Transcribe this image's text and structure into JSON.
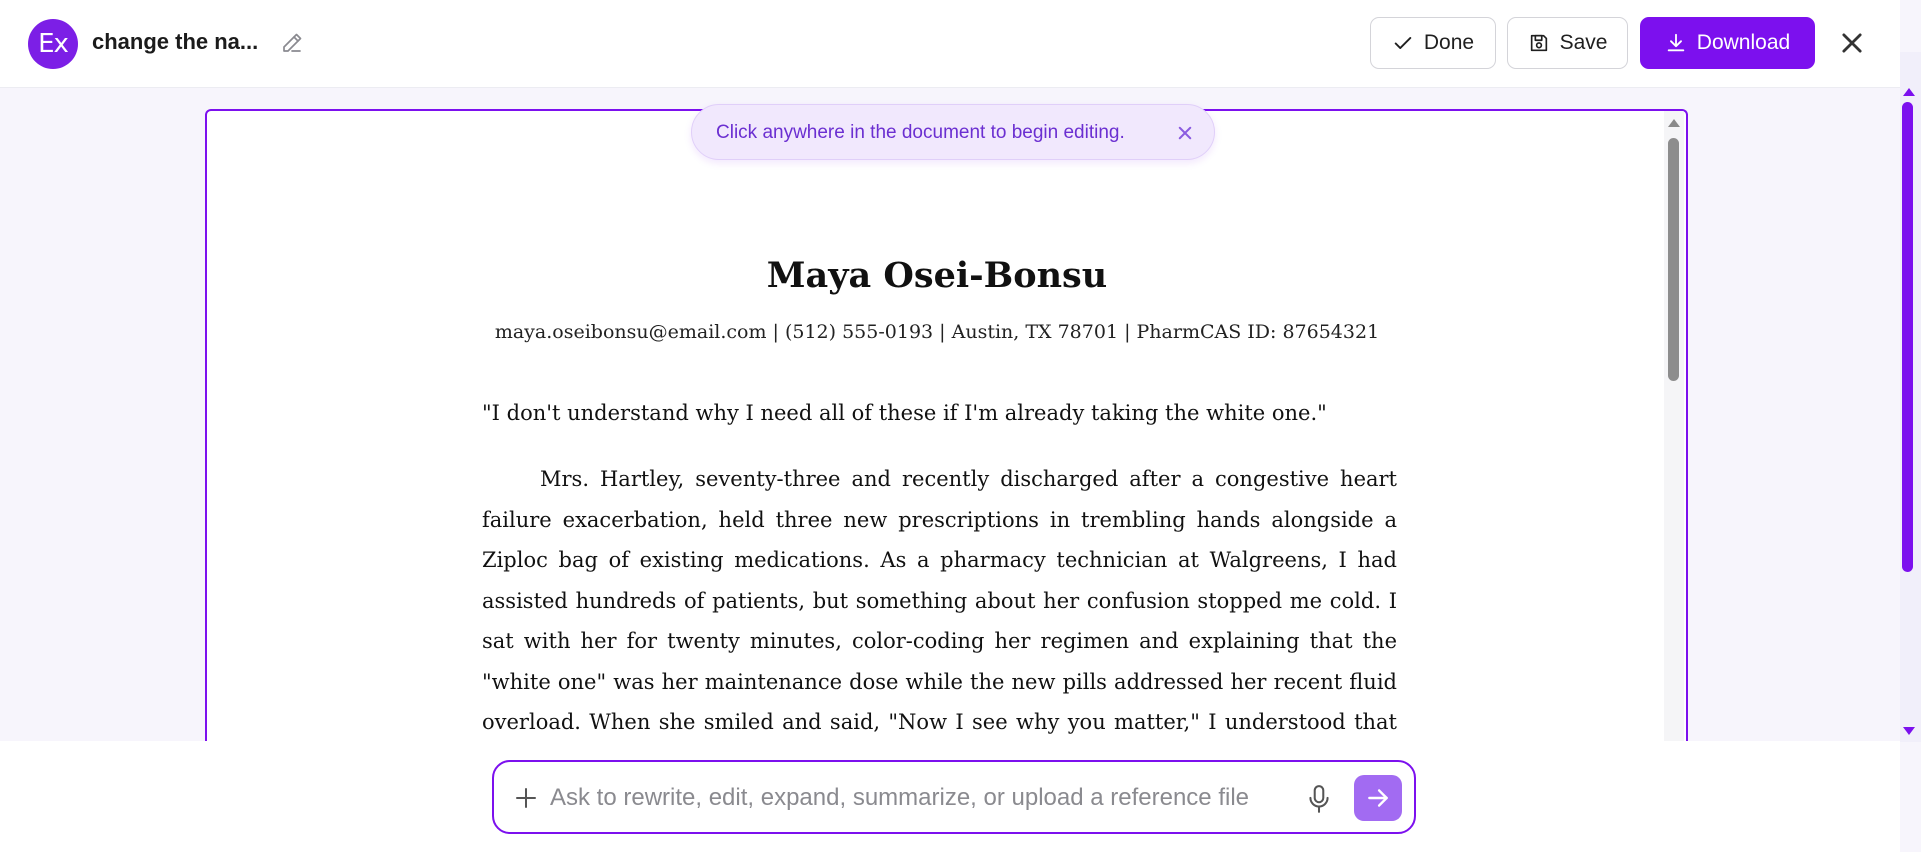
{
  "header": {
    "logo_text": "Ex",
    "doc_title": "change the na...",
    "buttons": {
      "done": "Done",
      "save": "Save",
      "download": "Download"
    }
  },
  "tip": {
    "text": "Click anywhere in the document to begin editing."
  },
  "document": {
    "name": "Maya Osei-Bonsu",
    "contact": "maya.oseibonsu@email.com | (512) 555-0193 | Austin, TX 78701 | PharmCAS ID: 87654321",
    "quote": "\"I don't understand why I need all of these if I'm already taking the white one.\"",
    "body": "Mrs. Hartley, seventy-three and recently discharged after a congestive heart failure exacerbation, held three new prescriptions in trembling hands alongside a Ziploc bag of existing medications. As a pharmacy technician at Walgreens, I had assisted hundreds of patients, but something about her confusion stopped me cold. I sat with her for twenty minutes, color-coding her regimen and explaining that the \"white one\" was her maintenance dose while the new pills addressed her recent fluid overload. When she smiled and said, \"Now I see why you matter,\" I understood that the pharmacist's role"
  },
  "prompt": {
    "placeholder": "Ask to rewrite, edit, expand, summarize, or upload a reference file",
    "value": ""
  },
  "colors": {
    "accent": "#7c10ee",
    "tip_background": "#f1e8fd",
    "tip_text": "#6b2fd1",
    "send_button": "#a26bf2"
  },
  "icons": {
    "edit": "pencil-icon",
    "done": "check-icon",
    "save": "floppy-disk-icon",
    "download": "download-icon",
    "close": "close-icon",
    "tip_close": "close-icon",
    "attach": "plus-icon",
    "voice": "microphone-icon",
    "send": "arrow-right-icon"
  }
}
